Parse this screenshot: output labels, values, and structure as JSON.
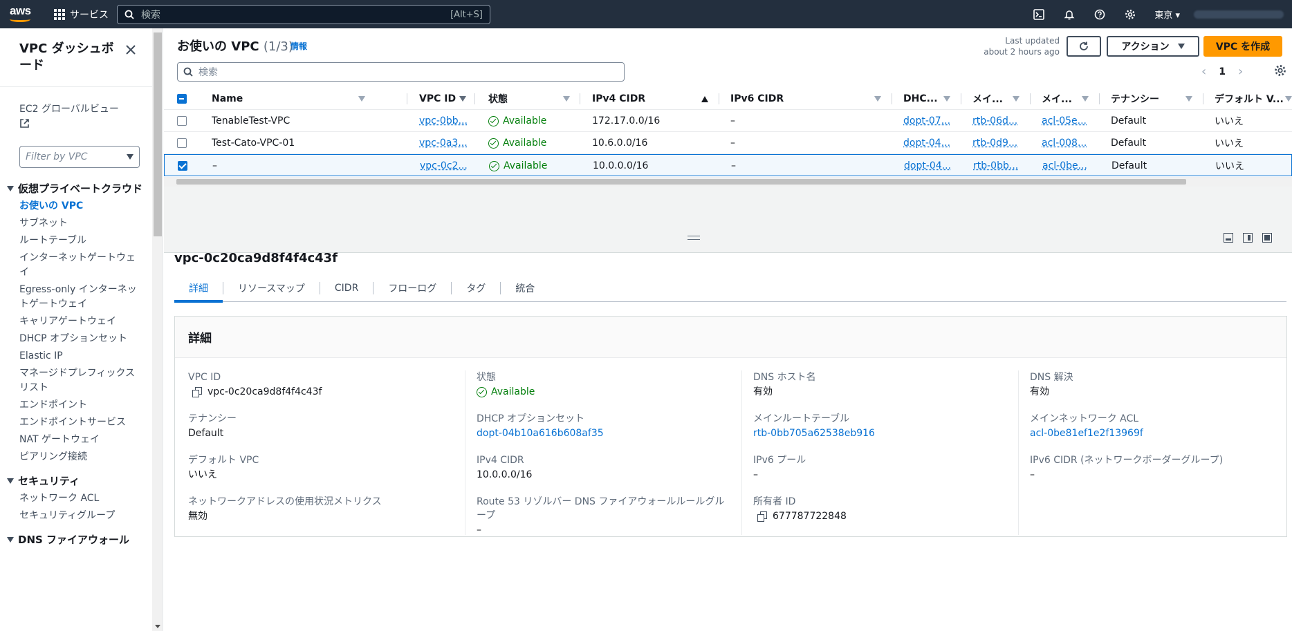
{
  "topnav": {
    "logo": "aws",
    "services": "サービス",
    "search_placeholder": "検索",
    "search_shortcut": "[Alt+S]",
    "region": "東京"
  },
  "sidebar": {
    "title": "VPC ダッシュボード",
    "ec2_global": "EC2 グローバルビュー",
    "filter_placeholder": "Filter by VPC",
    "sections": [
      {
        "label": "仮想プライベートクラウド",
        "items": [
          "お使いの VPC",
          "サブネット",
          "ルートテーブル",
          "インターネットゲートウェイ",
          "Egress-only インターネットゲートウェイ",
          "キャリアゲートウェイ",
          "DHCP オプションセット",
          "Elastic IP",
          "マネージドプレフィックスリスト",
          "エンドポイント",
          "エンドポイントサービス",
          "NAT ゲートウェイ",
          "ピアリング接続"
        ]
      },
      {
        "label": "セキュリティ",
        "items": [
          "ネットワーク ACL",
          "セキュリティグループ"
        ]
      },
      {
        "label": "DNS ファイアウォール",
        "items": []
      }
    ],
    "active_item": "お使いの VPC"
  },
  "header": {
    "title": "お使いの VPC",
    "count": "(1/3)",
    "info": "情報",
    "last_updated_1": "Last updated",
    "last_updated_2": "about 2 hours ago",
    "actions_label": "アクション",
    "create_label": "VPC を作成",
    "search_placeholder": "検索",
    "page": "1"
  },
  "table": {
    "columns": [
      "Name",
      "VPC ID",
      "状態",
      "IPv4 CIDR",
      "IPv6 CIDR",
      "DHC...",
      "メイ...",
      "メイ...",
      "テナンシー",
      "デフォルト V..."
    ],
    "rows": [
      {
        "name": "TenableTest-VPC",
        "vpc_id": "vpc-0bb...",
        "state": "Available",
        "ipv4": "172.17.0.0/16",
        "ipv6": "–",
        "dhcp": "dopt-07...",
        "rtb": "rtb-06d...",
        "acl": "acl-05e...",
        "tenancy": "Default",
        "default": "いいえ",
        "selected": false
      },
      {
        "name": "Test-Cato-VPC-01",
        "vpc_id": "vpc-0a3...",
        "state": "Available",
        "ipv4": "10.6.0.0/16",
        "ipv6": "–",
        "dhcp": "dopt-04...",
        "rtb": "rtb-0d9...",
        "acl": "acl-008...",
        "tenancy": "Default",
        "default": "いいえ",
        "selected": false
      },
      {
        "name": "–",
        "vpc_id": "vpc-0c2...",
        "state": "Available",
        "ipv4": "10.0.0.0/16",
        "ipv6": "–",
        "dhcp": "dopt-04...",
        "rtb": "rtb-0bb...",
        "acl": "acl-0be...",
        "tenancy": "Default",
        "default": "いいえ",
        "selected": true
      }
    ]
  },
  "detail": {
    "vpc_title": "vpc-0c20ca9d8f4f4c43f",
    "tabs": [
      "詳細",
      "リソースマップ",
      "CIDR",
      "フローログ",
      "タグ",
      "統合"
    ],
    "section_title": "詳細",
    "col1": [
      {
        "k": "VPC ID",
        "v": "vpc-0c20ca9d8f4f4c43f"
      },
      {
        "k": "テナンシー",
        "v": "Default"
      },
      {
        "k": "デフォルト VPC",
        "v": "いいえ"
      },
      {
        "k": "ネットワークアドレスの使用状況メトリクス",
        "v": "無効"
      }
    ],
    "col2": [
      {
        "k": "状態",
        "v": "Available"
      },
      {
        "k": "DHCP オプションセット",
        "v": "dopt-04b10a616b608af35"
      },
      {
        "k": "IPv4 CIDR",
        "v": "10.0.0.0/16"
      },
      {
        "k": "Route 53 リゾルバー DNS ファイアウォールルールグループ",
        "v": "–"
      }
    ],
    "col3": [
      {
        "k": "DNS ホスト名",
        "v": "有効"
      },
      {
        "k": "メインルートテーブル",
        "v": "rtb-0bb705a62538eb916"
      },
      {
        "k": "IPv6 プール",
        "v": "–"
      },
      {
        "k": "所有者 ID",
        "v": "677787722848"
      }
    ],
    "col4": [
      {
        "k": "DNS 解決",
        "v": "有効"
      },
      {
        "k": "メインネットワーク ACL",
        "v": "acl-0be81ef1e2f13969f"
      },
      {
        "k": "IPv6 CIDR (ネットワークボーダーグループ)",
        "v": "–"
      }
    ]
  },
  "colors": {
    "nav_bg": "#232f3e",
    "link": "#0972d3",
    "success": "#037f0c",
    "primary_btn": "#ff9900"
  }
}
